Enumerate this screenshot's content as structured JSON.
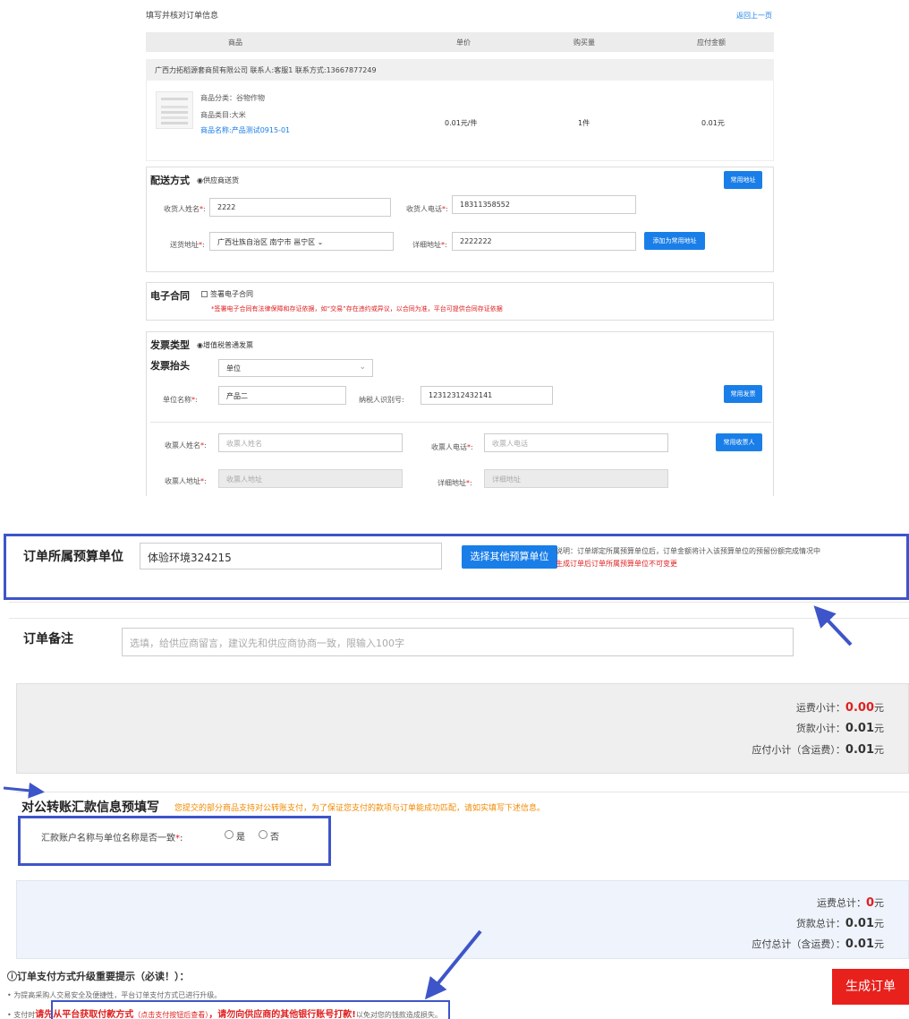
{
  "header": {
    "title": "填写并核对订单信息",
    "back_link": "返回上一页"
  },
  "table": {
    "columns": [
      "商品",
      "单价",
      "购买量",
      "应付金额"
    ],
    "supplier": "广西力拓稻源套商贸有限公司   联系人:客服1   联系方式:13667877249",
    "item": {
      "category": "商品分类：谷物作物",
      "type": "商品类目:大米",
      "name": "商品名称:产品测试0915-01",
      "unit_price": "0.01元/件",
      "qty": "1件",
      "amount": "0.01元"
    }
  },
  "delivery": {
    "title": "配送方式",
    "method": "◉供应商送货",
    "common_addr_btn": "常用地址",
    "name_label": "收货人姓名",
    "name_value": "2222",
    "phone_label": "收货人电话",
    "phone_value": "18311358552",
    "addr_label": "送货地址",
    "addr_value": "广西壮族自治区   南宁市   邕宁区   ⌄",
    "detail_label": "详细地址",
    "detail_value": "2222222",
    "add_common_btn": "添加为常用地址"
  },
  "contract": {
    "title": "电子合同",
    "checkbox_label": "签署电子合同",
    "note": "*签署电子合同有法律保障和存证依据，如“交易”存在违约或异议，以合同为准，平台可提供合同存证依据"
  },
  "invoice": {
    "type_title": "发票类型",
    "type_value": "◉增值税普通发票",
    "header_title": "发票抬头",
    "header_select": "单位",
    "unit_label": "单位名称",
    "unit_value": "产品二",
    "tax_label": "纳税人识别号:",
    "tax_value": "12312312432141",
    "common_invoice_btn": "常用发票",
    "recv_name_label": "收票人姓名",
    "recv_name_ph": "收票人姓名",
    "recv_phone_label": "收票人电话",
    "recv_phone_ph": "收票人电话",
    "common_recv_btn": "常用收票人",
    "recv_addr_label": "收票人地址",
    "recv_addr_ph": "收票人地址",
    "recv_detail_label": "详细地址",
    "recv_detail_ph": "详细地址"
  },
  "budget": {
    "title": "订单所属预算单位",
    "value": "体验环境324215",
    "button": "选择其他预算单位",
    "note1": "说明：订单绑定所属预算单位后，订单金额将计入该预算单位的预留份额完成情况中",
    "note2": "生成订单后订单所属预算单位不可变更"
  },
  "remark": {
    "title": "订单备注",
    "placeholder": "选填，给供应商留言，建议先和供应商协商一致，限输入100字"
  },
  "subtotal": {
    "freight_label": "运费小计：",
    "freight_value": "0.00",
    "goods_label": "货款小计：",
    "goods_value": "0.01",
    "payable_label": "应付小计（含运费）：",
    "payable_value": "0.01",
    "unit": "元"
  },
  "transfer": {
    "title": "对公转账汇款信息预填写",
    "note": "您提交的部分商品支持对公转账支付，为了保证您支付的款项与订单能成功匹配，请如实填写下述信息。",
    "question": "汇款账户名称与单位名称是否一致",
    "opt_yes": "是",
    "opt_no": "否"
  },
  "total": {
    "freight_label": "运费总计：",
    "freight_value": "0",
    "goods_label": "货款总计：",
    "goods_value": "0.01",
    "payable_label": "应付总计（含运费）：",
    "payable_value": "0.01",
    "unit": "元"
  },
  "notice": {
    "title": "ⓘ订单支付方式升级重要提示（必读！）：",
    "line1": "• 为提高采购人交易安全及便捷性，平台订单支付方式已进行升级。",
    "line2_prefix": "• 支付时",
    "line2_red1": "请先从平台获取付款方式",
    "line2_red_small": "（点击支付按钮后查看）",
    "line2_red2": "，请勿向供应商的其他银行账号打款!",
    "line2_suffix": "以免对您的钱款造成损失。"
  },
  "submit_button": "生成订单",
  "colors": {
    "accent": "#1a7ee8",
    "danger": "#e02020",
    "warn": "#f08a00",
    "annotation": "#3d55c9"
  }
}
